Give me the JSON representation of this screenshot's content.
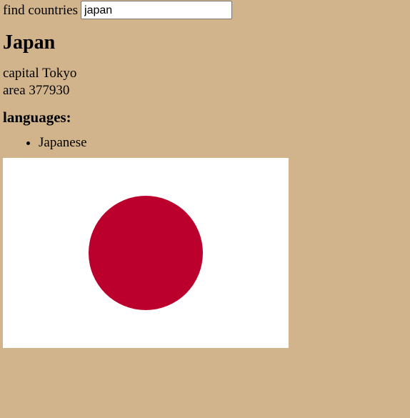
{
  "search": {
    "label": "find countries",
    "value": "japan"
  },
  "country": {
    "name": "Japan",
    "capital_label": "capital",
    "capital": "Tokyo",
    "area_label": "area",
    "area": "377930",
    "languages_heading": "languages:",
    "languages": [
      "Japanese"
    ]
  },
  "flag": {
    "icon": "japan-flag-icon",
    "background_color": "#ffffff",
    "disc_color": "#bc002d"
  },
  "colors": {
    "page_background": "#d2b48c"
  }
}
